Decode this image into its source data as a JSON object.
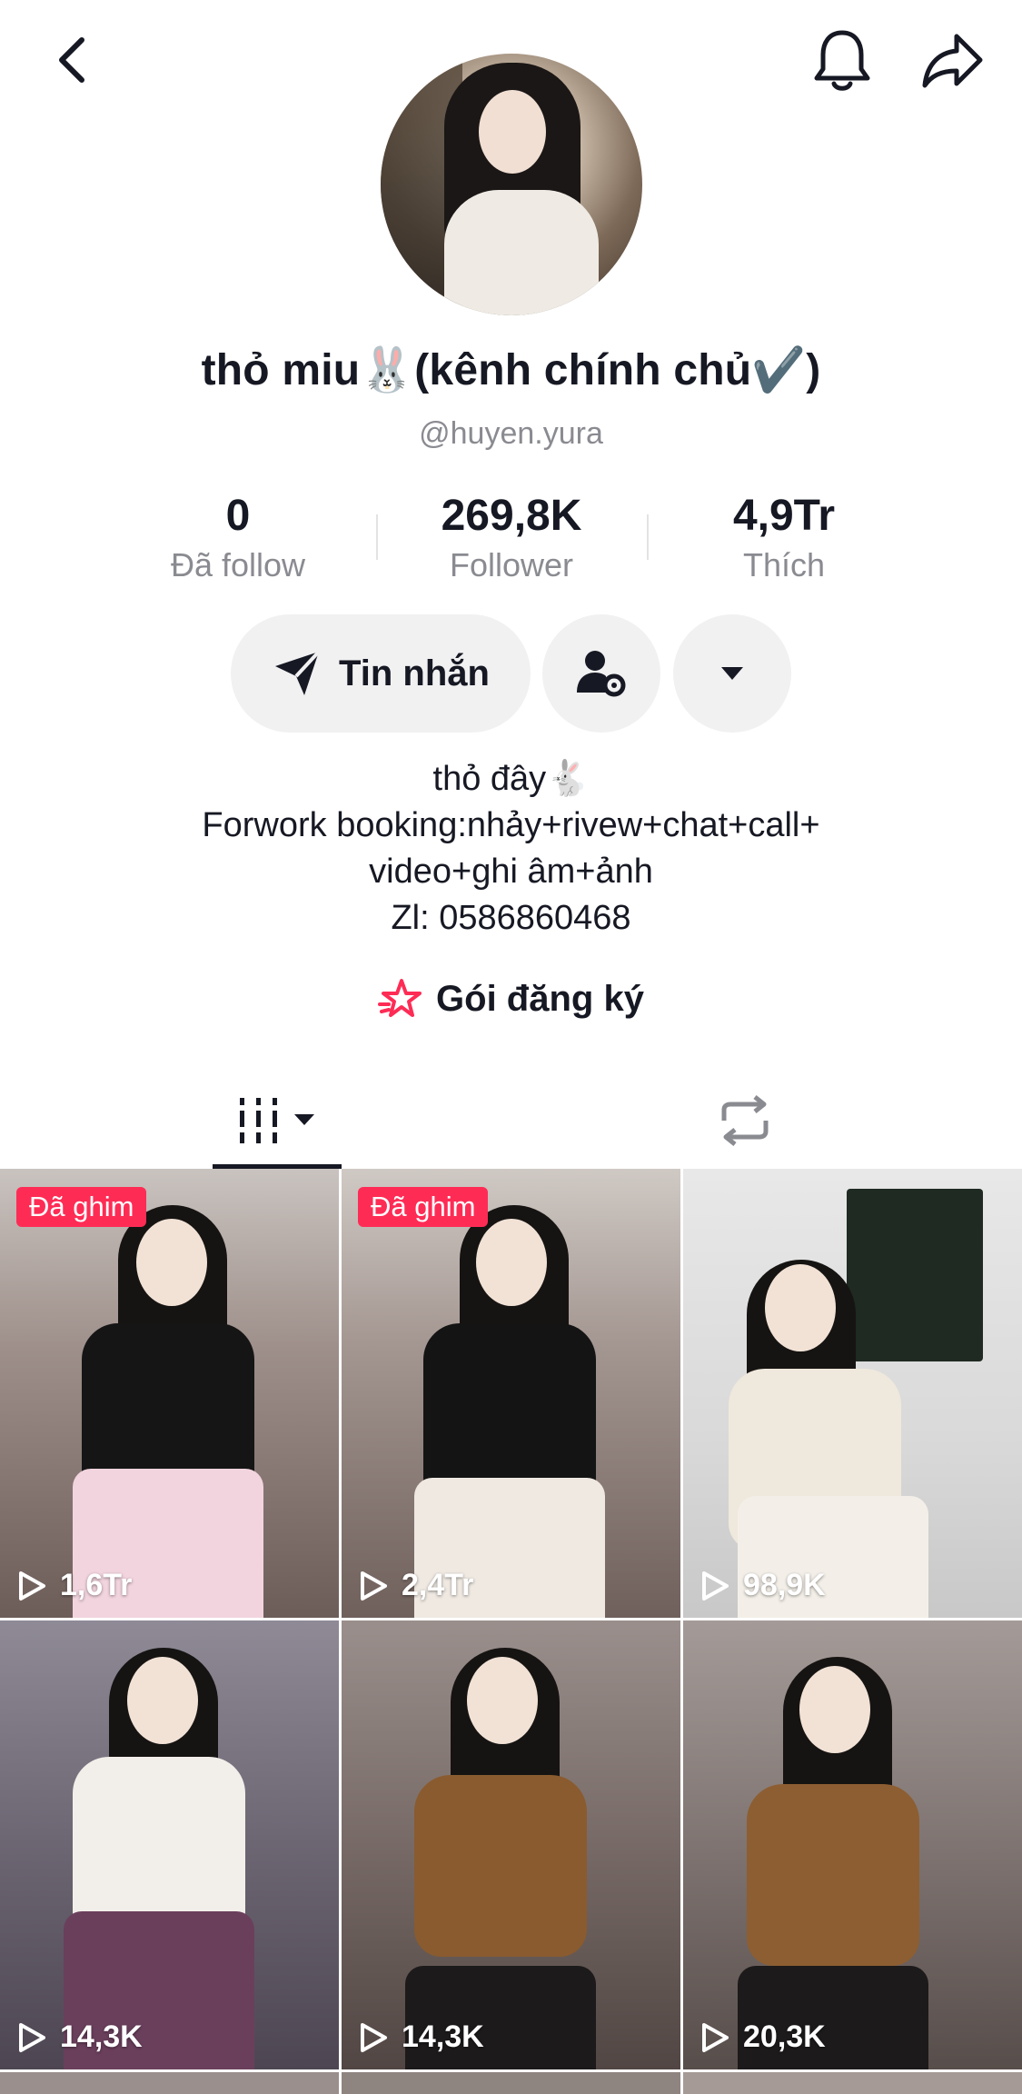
{
  "profile": {
    "display_name": "thỏ miu🐰(kênh chính chủ✔️)",
    "handle": "@huyen.yura"
  },
  "stats": [
    {
      "value": "0",
      "label": "Đã follow"
    },
    {
      "value": "269,8K",
      "label": "Follower"
    },
    {
      "value": "4,9Tr",
      "label": "Thích"
    }
  ],
  "actions": {
    "message_label": "Tin nhắn"
  },
  "bio": {
    "line1": "thỏ đây🐇",
    "line2": "Forwork booking:nhảy+rivew+chat+call+",
    "line3": "video+ghi âm+ảnh",
    "line4": "Zl: 0586860468"
  },
  "subscription": {
    "label": "Gói đăng ký"
  },
  "videos": [
    {
      "pinned_label": "Đã ghim",
      "views": "1,6Tr"
    },
    {
      "pinned_label": "Đã ghim",
      "views": "2,4Tr"
    },
    {
      "pinned_label": "",
      "views": "98,9K"
    },
    {
      "pinned_label": "",
      "views": "14,3K"
    },
    {
      "pinned_label": "",
      "views": "14,3K"
    },
    {
      "pinned_label": "",
      "views": "20,3K"
    }
  ],
  "colors": {
    "accent": "#fe2c55",
    "text_primary": "#161823",
    "text_secondary": "#8a8b91",
    "button_bg": "#f1f1f2"
  },
  "icons": [
    "back-icon",
    "bell-icon",
    "share-icon",
    "send-icon",
    "user-settings-icon",
    "chevron-down-icon",
    "subscription-star-icon",
    "video-grid-icon",
    "repost-icon",
    "play-icon"
  ]
}
